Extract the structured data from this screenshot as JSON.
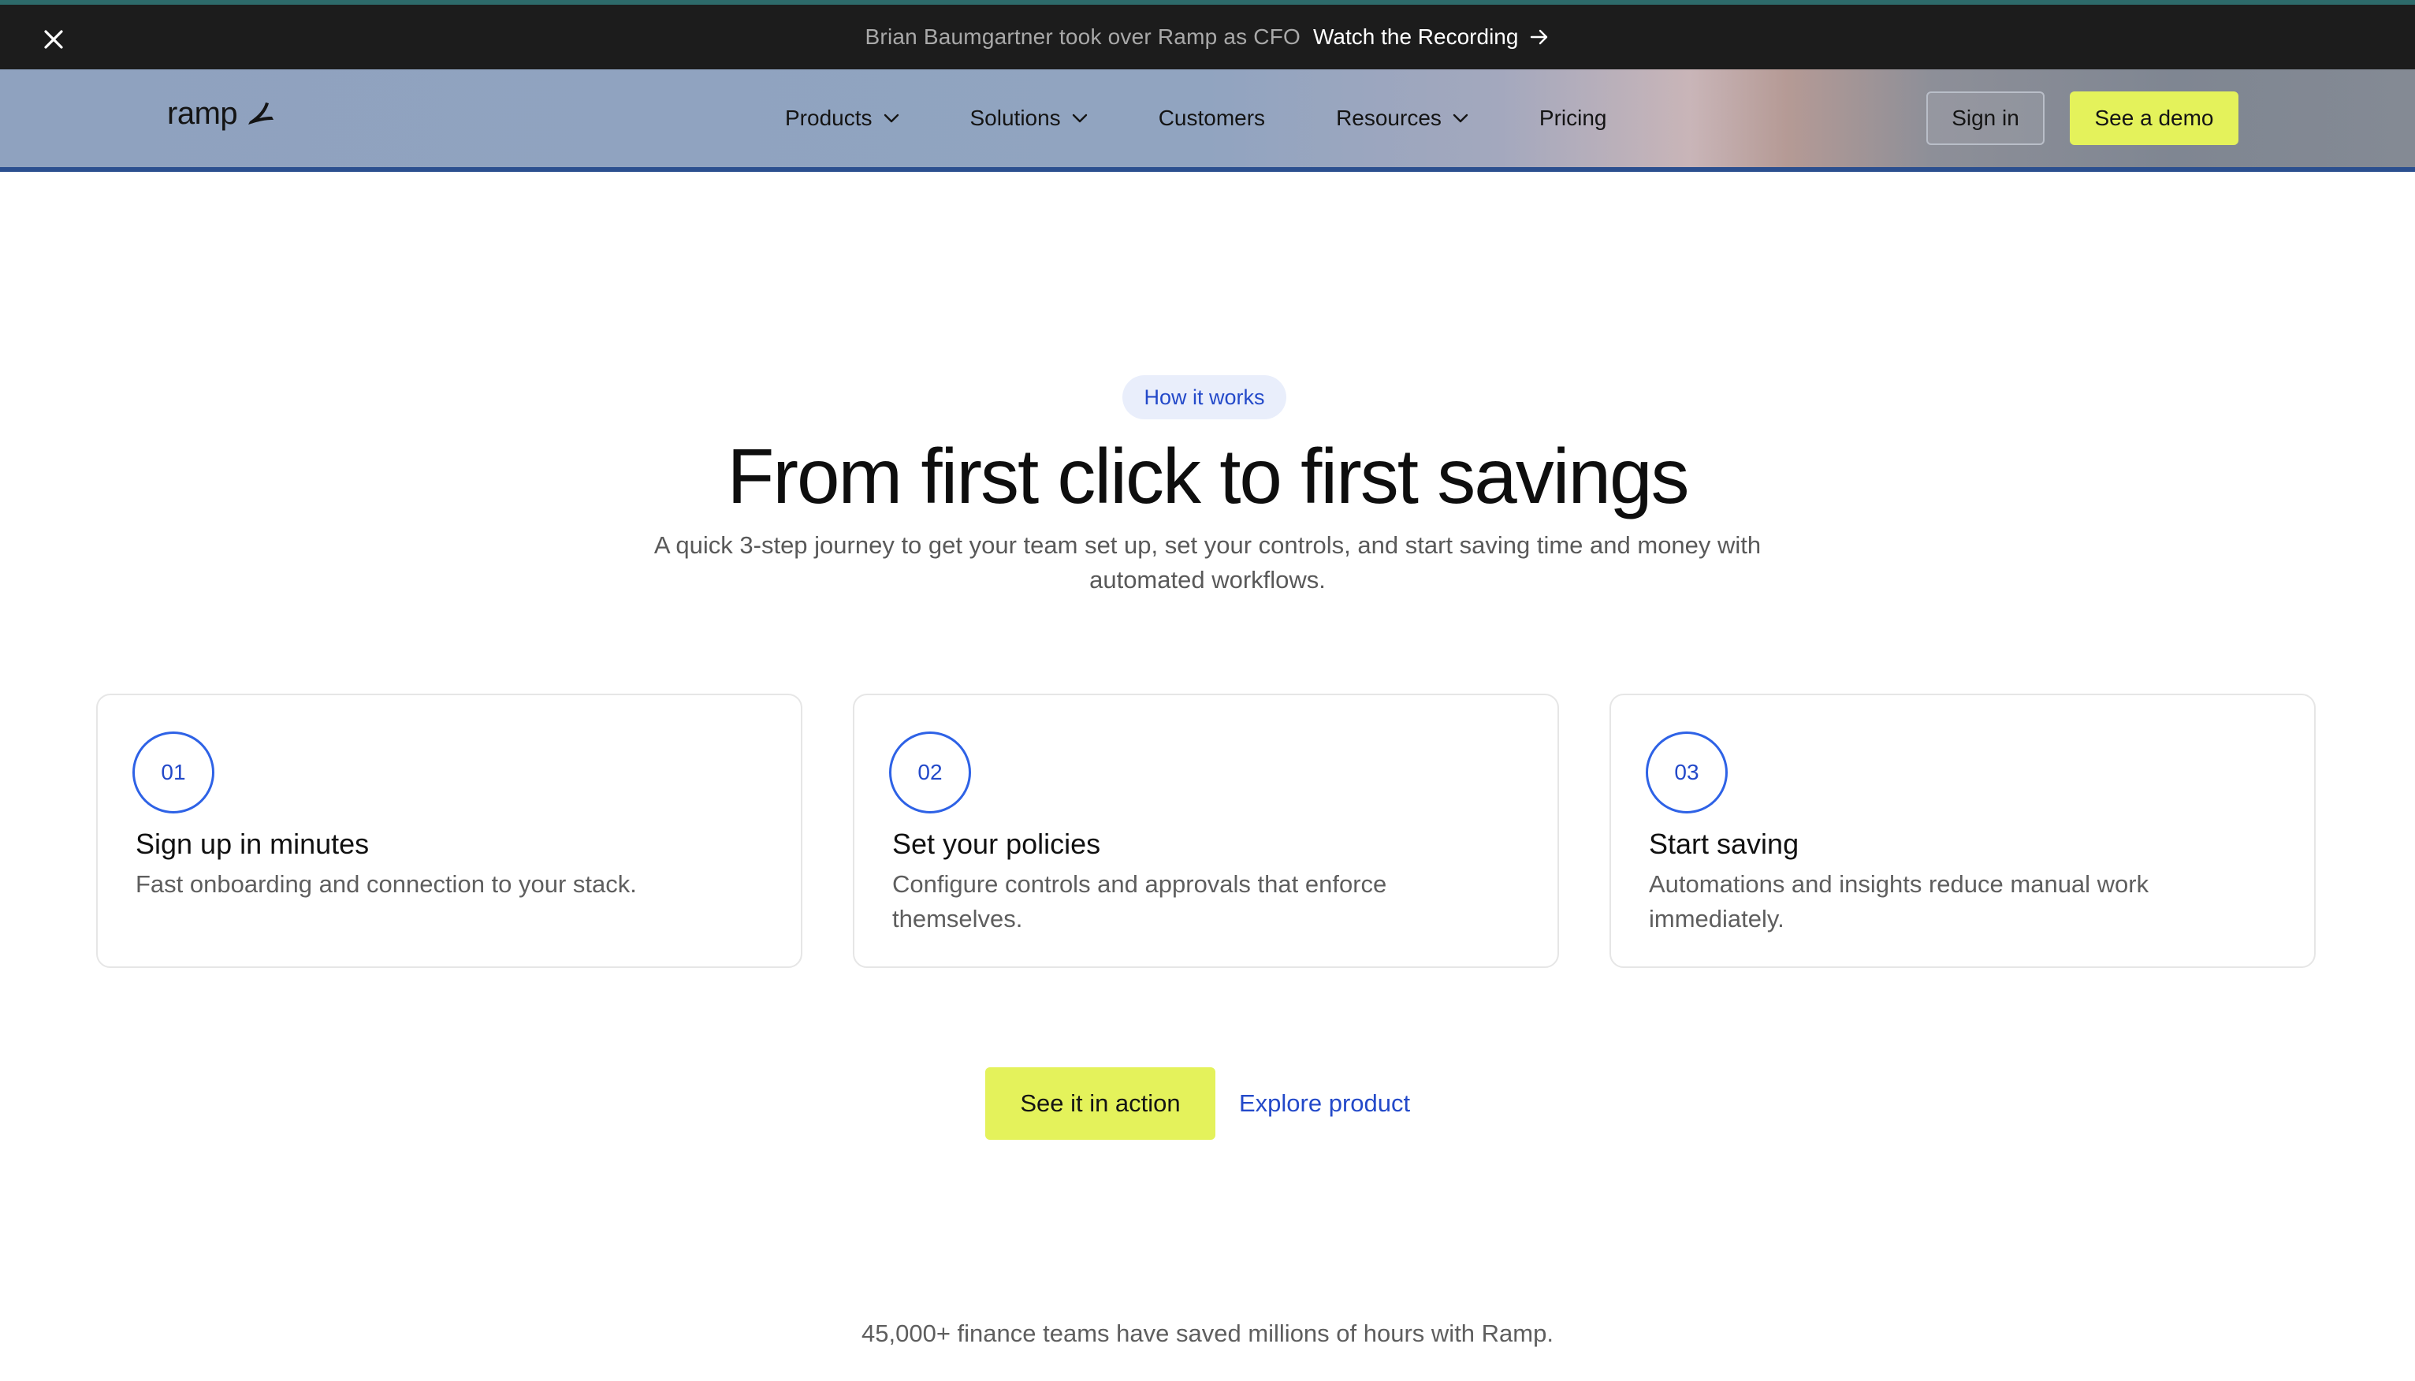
{
  "announcement": {
    "message": "Brian Baumgartner took over Ramp as CFO",
    "link_label": "Watch the Recording"
  },
  "nav": {
    "logo_text": "ramp",
    "items": [
      {
        "label": "Products",
        "has_dropdown": true
      },
      {
        "label": "Solutions",
        "has_dropdown": true
      },
      {
        "label": "Customers",
        "has_dropdown": false
      },
      {
        "label": "Resources",
        "has_dropdown": true
      },
      {
        "label": "Pricing",
        "has_dropdown": false
      }
    ],
    "signin_label": "Sign in",
    "demo_label": "See a demo"
  },
  "hero": {
    "badge": "How it works",
    "title": "From first click to first savings",
    "subtitle": "A quick 3-step journey to get your team set up, set your controls, and start saving time and money with automated workflows."
  },
  "steps": [
    {
      "number": "01",
      "title": "Sign up in minutes",
      "description": "Fast onboarding and connection to your stack."
    },
    {
      "number": "02",
      "title": "Set your policies",
      "description": "Configure controls and approvals that enforce themselves."
    },
    {
      "number": "03",
      "title": "Start saving",
      "description": "Automations and insights reduce manual work immediately."
    }
  ],
  "cta": {
    "primary_label": "See it in action",
    "secondary_label": "Explore product"
  },
  "social_proof": "45,000+ finance teams have saved millions of hours with Ramp.",
  "colors": {
    "accent_yellow": "#e4f25b",
    "accent_blue": "#2349c9",
    "announcement_bg": "#1c1c1c"
  }
}
